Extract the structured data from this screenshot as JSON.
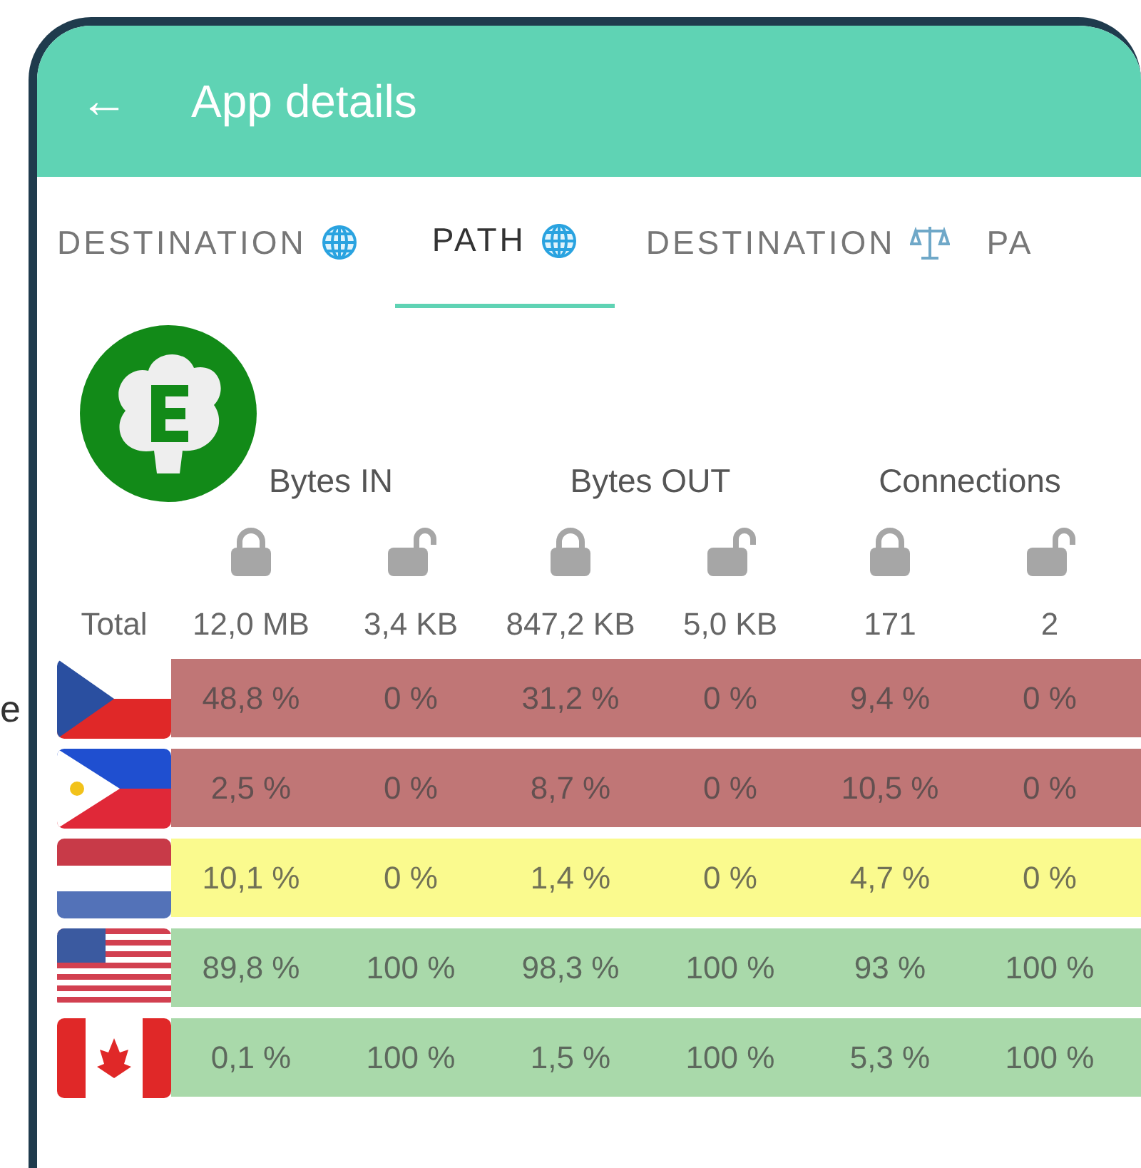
{
  "edge_text": "e",
  "app_bar": {
    "back": "←",
    "title": "App details"
  },
  "tabs": [
    {
      "label": "DESTINATION",
      "kind": "globe",
      "selected": false
    },
    {
      "label": "PATH",
      "kind": "globe",
      "selected": true
    },
    {
      "label": "DESTINATION",
      "kind": "scales",
      "selected": false
    },
    {
      "label": "PA",
      "kind": "none",
      "selected": false
    }
  ],
  "column_groups": [
    "Bytes IN",
    "Bytes OUT",
    "Connections"
  ],
  "locks": [
    {
      "locked": true
    },
    {
      "locked": false
    },
    {
      "locked": true
    },
    {
      "locked": false
    },
    {
      "locked": true
    },
    {
      "locked": false
    }
  ],
  "total": {
    "label": "Total",
    "values": [
      "12,0 MB",
      "3,4 KB",
      "847,2 KB",
      "5,0 KB",
      "171",
      "2"
    ]
  },
  "rows": [
    {
      "kind": "cz",
      "color": "#c07676",
      "values": [
        "48,8 %",
        "0 %",
        "31,2 %",
        "0 %",
        "9,4 %",
        "0 %"
      ]
    },
    {
      "kind": "ph",
      "color": "#c07676",
      "values": [
        "2,5 %",
        "0 %",
        "8,7 %",
        "0 %",
        "10,5 %",
        "0 %"
      ]
    },
    {
      "kind": "nl",
      "color": "#fafa8e",
      "values": [
        "10,1 %",
        "0 %",
        "1,4 %",
        "0 %",
        "4,7 %",
        "0 %"
      ]
    },
    {
      "kind": "us",
      "color": "#a9d9aa",
      "values": [
        "89,8 %",
        "100 %",
        "98,3 %",
        "100 %",
        "93 %",
        "100 %"
      ]
    },
    {
      "kind": "ca",
      "color": "#a9d9aa",
      "values": [
        "0,1 %",
        "100 %",
        "1,5 %",
        "100 %",
        "5,3 %",
        "100 %"
      ]
    }
  ]
}
